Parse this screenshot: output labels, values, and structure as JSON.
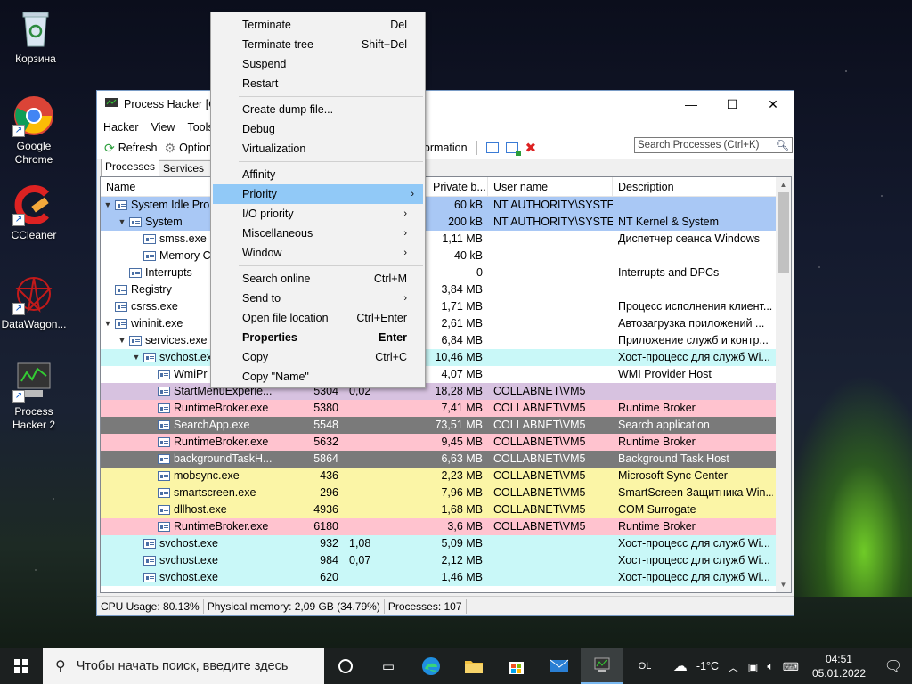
{
  "desktop": {
    "icons": [
      {
        "label": "Корзина"
      },
      {
        "label": "Google\nChrome"
      },
      {
        "label": "CCleaner"
      },
      {
        "label": "DataWagon..."
      },
      {
        "label": "Process\nHacker 2"
      }
    ]
  },
  "window": {
    "title": "Process Hacker [CC",
    "menu": [
      "Hacker",
      "View",
      "Tools"
    ],
    "toolbar": {
      "refresh": "Refresh",
      "options": "Option",
      "info": "ormation"
    },
    "search_placeholder": "Search Processes (Ctrl+K)",
    "tabs": [
      "Processes",
      "Services",
      "N"
    ],
    "columns": [
      "Name",
      "Private b...",
      "User name",
      "Description"
    ],
    "rows": [
      {
        "name": "System Idle Pro",
        "pid": "",
        "cpu": "",
        "priv": "60 kB",
        "user": "NT AUTHORITY\\SYSTEM",
        "desc": "",
        "indent": 0,
        "exp": "▼",
        "bg": "#a9c8f5"
      },
      {
        "name": "System",
        "pid": "",
        "cpu": "",
        "priv": "200 kB",
        "user": "NT AUTHORITY\\SYSTEM",
        "desc": "NT Kernel & System",
        "indent": 1,
        "exp": "▼",
        "bg": "#a9c8f5"
      },
      {
        "name": "smss.exe",
        "pid": "",
        "cpu": "",
        "priv": "1,11 MB",
        "user": "",
        "desc": "Диспетчер сеанса  Windows",
        "indent": 2,
        "exp": "",
        "bg": "#ffffff"
      },
      {
        "name": "Memory C",
        "pid": "",
        "cpu": "",
        "priv": "40 kB",
        "user": "",
        "desc": "",
        "indent": 2,
        "exp": "",
        "bg": "#ffffff"
      },
      {
        "name": "Interrupts",
        "pid": "",
        "cpu": "",
        "priv": "0",
        "user": "",
        "desc": "Interrupts and DPCs",
        "indent": 1,
        "exp": "",
        "bg": "#ffffff"
      },
      {
        "name": "Registry",
        "pid": "",
        "cpu": "",
        "priv": "3,84 MB",
        "user": "",
        "desc": "",
        "indent": 0,
        "exp": "",
        "bg": "#ffffff"
      },
      {
        "name": "csrss.exe",
        "pid": "",
        "cpu": "",
        "priv": "1,71 MB",
        "user": "",
        "desc": "Процесс исполнения клиент...",
        "indent": 0,
        "exp": "",
        "bg": "#ffffff"
      },
      {
        "name": "wininit.exe",
        "pid": "",
        "cpu": "",
        "priv": "2,61 MB",
        "user": "",
        "desc": "Автозагрузка приложений ...",
        "indent": 0,
        "exp": "▼",
        "bg": "#ffffff"
      },
      {
        "name": "services.exe",
        "pid": "",
        "cpu": "",
        "priv": "6,84 MB",
        "user": "",
        "desc": "Приложение служб и контр...",
        "indent": 1,
        "exp": "▼",
        "bg": "#ffffff"
      },
      {
        "name": "svchost.ex",
        "pid": "",
        "cpu": "",
        "priv": "10,46 MB",
        "user": "",
        "desc": "Хост-процесс для служб Wi...",
        "indent": 2,
        "exp": "▼",
        "bg": "#c9f8f8"
      },
      {
        "name": "WmiPr",
        "pid": "",
        "cpu": "",
        "priv": "4,07 MB",
        "user": "",
        "desc": "WMI Provider Host",
        "indent": 3,
        "exp": "",
        "bg": "#ffffff"
      },
      {
        "name": "StartMenuExperie...",
        "pid": "5304",
        "cpu": "0,02",
        "priv": "18,28 MB",
        "user": "COLLABNET\\VM5",
        "desc": "",
        "indent": 3,
        "exp": "",
        "bg": "#d7c2e0"
      },
      {
        "name": "RuntimeBroker.exe",
        "pid": "5380",
        "cpu": "",
        "priv": "7,41 MB",
        "user": "COLLABNET\\VM5",
        "desc": "Runtime Broker",
        "indent": 3,
        "exp": "",
        "bg": "#ffc3cf"
      },
      {
        "name": "SearchApp.exe",
        "pid": "5548",
        "cpu": "",
        "priv": "73,51 MB",
        "user": "COLLABNET\\VM5",
        "desc": "Search application",
        "indent": 3,
        "exp": "",
        "bg": "#7a7a7a"
      },
      {
        "name": "RuntimeBroker.exe",
        "pid": "5632",
        "cpu": "",
        "priv": "9,45 MB",
        "user": "COLLABNET\\VM5",
        "desc": "Runtime Broker",
        "indent": 3,
        "exp": "",
        "bg": "#ffc3cf"
      },
      {
        "name": "backgroundTaskH...",
        "pid": "5864",
        "cpu": "",
        "priv": "6,63 MB",
        "user": "COLLABNET\\VM5",
        "desc": "Background Task Host",
        "indent": 3,
        "exp": "",
        "bg": "#7a7a7a"
      },
      {
        "name": "mobsync.exe",
        "pid": "436",
        "cpu": "",
        "priv": "2,23 MB",
        "user": "COLLABNET\\VM5",
        "desc": "Microsoft Sync Center",
        "indent": 3,
        "exp": "",
        "bg": "#fbf5a6"
      },
      {
        "name": "smartscreen.exe",
        "pid": "296",
        "cpu": "",
        "priv": "7,96 MB",
        "user": "COLLABNET\\VM5",
        "desc": "SmartScreen Защитника Win...",
        "indent": 3,
        "exp": "",
        "bg": "#fbf5a6"
      },
      {
        "name": "dllhost.exe",
        "pid": "4936",
        "cpu": "",
        "priv": "1,68 MB",
        "user": "COLLABNET\\VM5",
        "desc": "COM Surrogate",
        "indent": 3,
        "exp": "",
        "bg": "#fbf5a6"
      },
      {
        "name": "RuntimeBroker.exe",
        "pid": "6180",
        "cpu": "",
        "priv": "3,6 MB",
        "user": "COLLABNET\\VM5",
        "desc": "Runtime Broker",
        "indent": 3,
        "exp": "",
        "bg": "#ffc3cf"
      },
      {
        "name": "svchost.exe",
        "pid": "932",
        "cpu": "1,08",
        "priv": "5,09 MB",
        "user": "",
        "desc": "Хост-процесс для служб Wi...",
        "indent": 2,
        "exp": "",
        "bg": "#c9f8f8"
      },
      {
        "name": "svchost.exe",
        "pid": "984",
        "cpu": "0,07",
        "priv": "2,12 MB",
        "user": "",
        "desc": "Хост-процесс для служб Wi...",
        "indent": 2,
        "exp": "",
        "bg": "#c9f8f8"
      },
      {
        "name": "svchost.exe",
        "pid": "620",
        "cpu": "",
        "priv": "1,46 MB",
        "user": "",
        "desc": "Хост-процесс для служб Wi...",
        "indent": 2,
        "exp": "",
        "bg": "#c9f8f8"
      }
    ],
    "status": {
      "cpu": "CPU Usage: 80.13%",
      "mem": "Physical memory: 2,09 GB (34.79%)",
      "proc": "Processes: 107"
    }
  },
  "context_menu": {
    "items": [
      {
        "label": "Terminate",
        "shortcut": "Del"
      },
      {
        "label": "Terminate tree",
        "shortcut": "Shift+Del"
      },
      {
        "label": "Suspend",
        "shortcut": ""
      },
      {
        "label": "Restart",
        "shortcut": ""
      },
      {
        "sep": true
      },
      {
        "label": "Create dump file...",
        "shortcut": ""
      },
      {
        "label": "Debug",
        "shortcut": ""
      },
      {
        "label": "Virtualization",
        "shortcut": ""
      },
      {
        "sep": true
      },
      {
        "label": "Affinity",
        "shortcut": ""
      },
      {
        "label": "Priority",
        "shortcut": "",
        "sub": true,
        "highlight": true
      },
      {
        "label": "I/O priority",
        "shortcut": "",
        "sub": true
      },
      {
        "label": "Miscellaneous",
        "shortcut": "",
        "sub": true
      },
      {
        "label": "Window",
        "shortcut": "",
        "sub": true
      },
      {
        "sep": true
      },
      {
        "label": "Search online",
        "shortcut": "Ctrl+M"
      },
      {
        "label": "Send to",
        "shortcut": "",
        "sub": true
      },
      {
        "label": "Open file location",
        "shortcut": "Ctrl+Enter"
      },
      {
        "label": "Properties",
        "shortcut": "Enter",
        "bold": true
      },
      {
        "label": "Copy",
        "shortcut": "Ctrl+C"
      },
      {
        "label": "Copy \"Name\"",
        "shortcut": ""
      }
    ]
  },
  "taskbar": {
    "search_placeholder": "Чтобы начать поиск, введите здесь",
    "weather": "-1°C",
    "lang": "OL",
    "time": "04:51",
    "date": "05.01.2022"
  }
}
